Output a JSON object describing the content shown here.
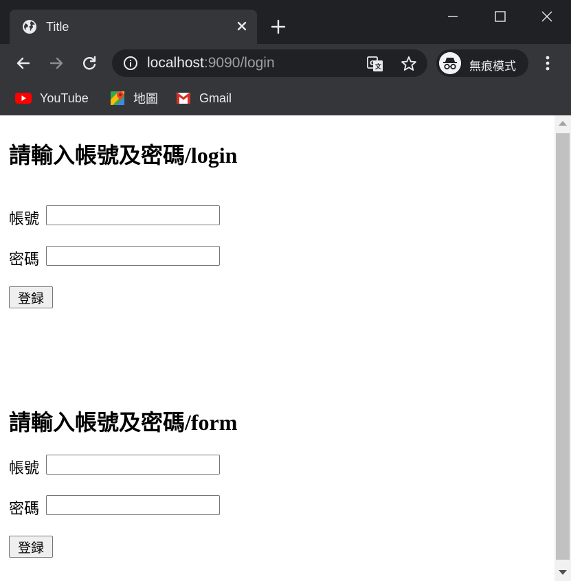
{
  "browser": {
    "tab": {
      "title": "Title"
    },
    "address": {
      "host": "localhost",
      "path": ":9090/login"
    },
    "profile": {
      "label": "無痕模式"
    },
    "bookmarks": [
      {
        "label": "YouTube",
        "icon": "youtube-icon"
      },
      {
        "label": "地圖",
        "icon": "maps-icon"
      },
      {
        "label": "Gmail",
        "icon": "gmail-icon"
      }
    ]
  },
  "page": {
    "login_form": {
      "heading": "請輸入帳號及密碼/login",
      "account_label": "帳號",
      "account_value": "",
      "password_label": "密碼",
      "password_value": "",
      "submit_label": "登録"
    },
    "form_form": {
      "heading": "請輸入帳號及密碼/form",
      "account_label": "帳號",
      "account_value": "",
      "password_label": "密碼",
      "password_value": "",
      "submit_label": "登録"
    }
  },
  "colors": {
    "frame": "#202124",
    "toolbar": "#35363a",
    "text_light": "#e8eaed",
    "url_muted": "#9aa0a6",
    "page_bg": "#ffffff"
  }
}
